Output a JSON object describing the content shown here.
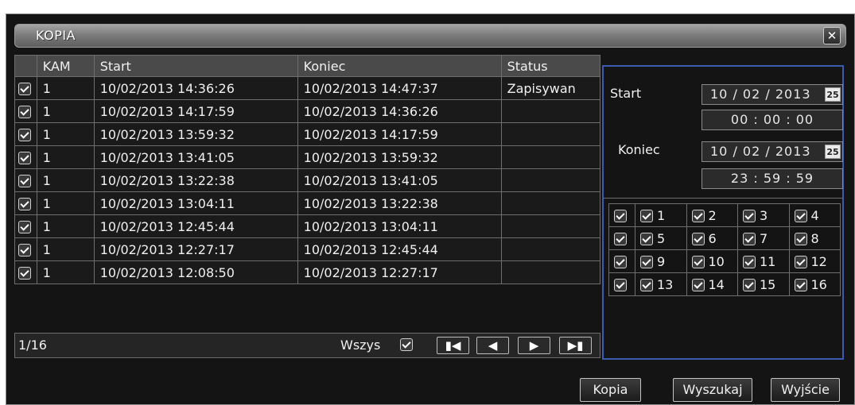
{
  "dialog": {
    "title": "KOPIA",
    "close_label": "✕"
  },
  "table": {
    "headers": [
      "",
      "KAM",
      "Start",
      "Koniec",
      "Status"
    ],
    "rows": [
      {
        "checked": true,
        "cam": "1",
        "start": "10/02/2013 14:36:26",
        "end": "10/02/2013 14:47:37",
        "status": "Zapisywan"
      },
      {
        "checked": true,
        "cam": "1",
        "start": "10/02/2013 14:17:59",
        "end": "10/02/2013 14:36:26",
        "status": ""
      },
      {
        "checked": true,
        "cam": "1",
        "start": "10/02/2013 13:59:32",
        "end": "10/02/2013 14:17:59",
        "status": ""
      },
      {
        "checked": true,
        "cam": "1",
        "start": "10/02/2013 13:41:05",
        "end": "10/02/2013 13:59:32",
        "status": ""
      },
      {
        "checked": true,
        "cam": "1",
        "start": "10/02/2013 13:22:38",
        "end": "10/02/2013 13:41:05",
        "status": ""
      },
      {
        "checked": true,
        "cam": "1",
        "start": "10/02/2013 13:04:11",
        "end": "10/02/2013 13:22:38",
        "status": ""
      },
      {
        "checked": true,
        "cam": "1",
        "start": "10/02/2013 12:45:44",
        "end": "10/02/2013 13:04:11",
        "status": ""
      },
      {
        "checked": true,
        "cam": "1",
        "start": "10/02/2013 12:27:17",
        "end": "10/02/2013 12:45:44",
        "status": ""
      },
      {
        "checked": true,
        "cam": "1",
        "start": "10/02/2013 12:08:50",
        "end": "10/02/2013 12:27:17",
        "status": ""
      }
    ]
  },
  "footer": {
    "page": "1/16",
    "select_all_label": "Wszys",
    "nav_icons": [
      "first-page-icon",
      "prev-page-icon",
      "next-page-icon",
      "last-page-icon"
    ]
  },
  "search_panel": {
    "start_label": "Start",
    "start_date": "10 / 02 / 2013",
    "start_time": "00  :  00  :  00",
    "end_label": "Koniec",
    "end_date": "10 / 02 / 2013",
    "end_time": "23  :  59  :  59",
    "calendar_label": "25"
  },
  "channels": {
    "rows": [
      [
        "1",
        "2",
        "3",
        "4"
      ],
      [
        "5",
        "6",
        "7",
        "8"
      ],
      [
        "9",
        "10",
        "11",
        "12"
      ],
      [
        "13",
        "14",
        "15",
        "16"
      ]
    ]
  },
  "buttons": {
    "copy": "Kopia",
    "search": "Wyszukaj",
    "exit": "Wyjście"
  },
  "colors": {
    "panel_border": "#3a5bb0",
    "background": "#141414"
  }
}
